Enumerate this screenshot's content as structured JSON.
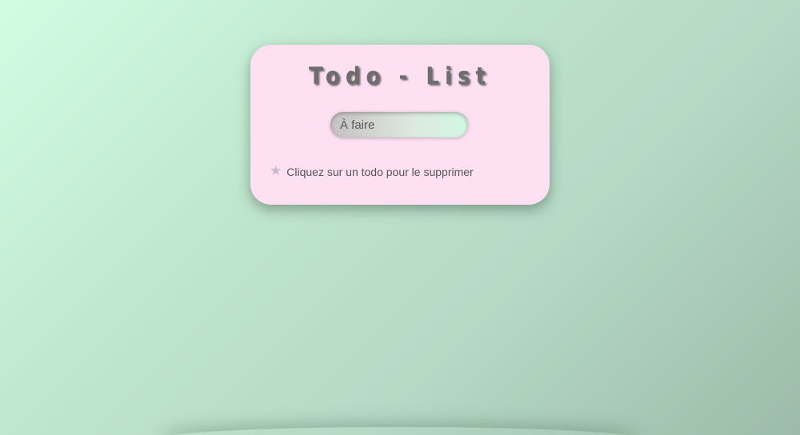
{
  "app": {
    "title": "Todo - List"
  },
  "todo_input": {
    "placeholder": "À faire",
    "value": ""
  },
  "hint": {
    "icon": "star-icon",
    "text": "Cliquez sur un todo pour le supprimer"
  },
  "colors": {
    "card_background": "#fde1f2",
    "title_color": "#6d6d6d",
    "background_start": "#d2fde3",
    "background_end": "#9dbba8"
  }
}
